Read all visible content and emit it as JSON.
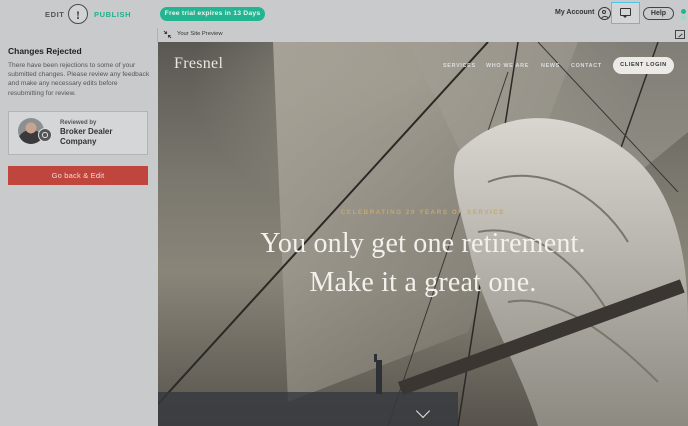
{
  "topbar": {
    "edit_label": "EDIT",
    "alert_glyph": "!",
    "publish_label": "PUBLISH",
    "trial_text": "Free trial expires in 13 Days",
    "account_label": "My Account",
    "help_label": "Help",
    "icons": [
      "alert-icon",
      "user-icon",
      "chat-icon",
      "status-icon"
    ],
    "colors": {
      "accent": "#23b592",
      "chat_highlight": "#4fc4e5"
    }
  },
  "panel": {
    "title": "Changes Rejected",
    "message": "There have been rejections to some of your submitted changes. Please review any feedback and make any necessary edits before resubmitting for review.",
    "reviewed_by_label": "Reviewed by",
    "reviewer_name": "Broker Dealer Company",
    "go_back_label": "Go back & Edit",
    "go_back_color": "#c0453d"
  },
  "preview": {
    "label": "Your Site Preview",
    "icons": [
      "shrink-icon",
      "expand-icon"
    ]
  },
  "site": {
    "logo": "Fresnel",
    "nav": [
      "SERVICES",
      "WHO WE ARE",
      "NEWS",
      "CONTACT"
    ],
    "client_login": "CLIENT LOGIN",
    "tagline": "CELEBRATING 20 YEARS OF SERVICE",
    "headline_line1": "You only get one retirement.",
    "headline_line2": "Make it a great one.",
    "tagline_color": "#c7a76a"
  }
}
